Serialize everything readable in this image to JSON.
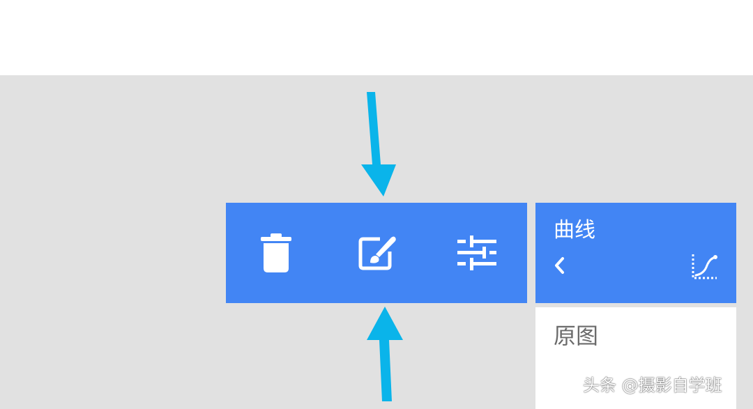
{
  "toolbar": {
    "tools": [
      {
        "icon": "trash-icon"
      },
      {
        "icon": "brush-edit-icon"
      },
      {
        "icon": "sliders-icon"
      }
    ],
    "color": "#4285f4"
  },
  "curve_panel": {
    "title": "曲线",
    "back_icon": "chevron-left-icon",
    "tool_icon": "curve-icon"
  },
  "preset_list": {
    "items": [
      "原图"
    ]
  },
  "annotation": {
    "arrow_color": "#0ab4ea"
  },
  "watermark": {
    "text": "头条 @摄影自学班"
  }
}
